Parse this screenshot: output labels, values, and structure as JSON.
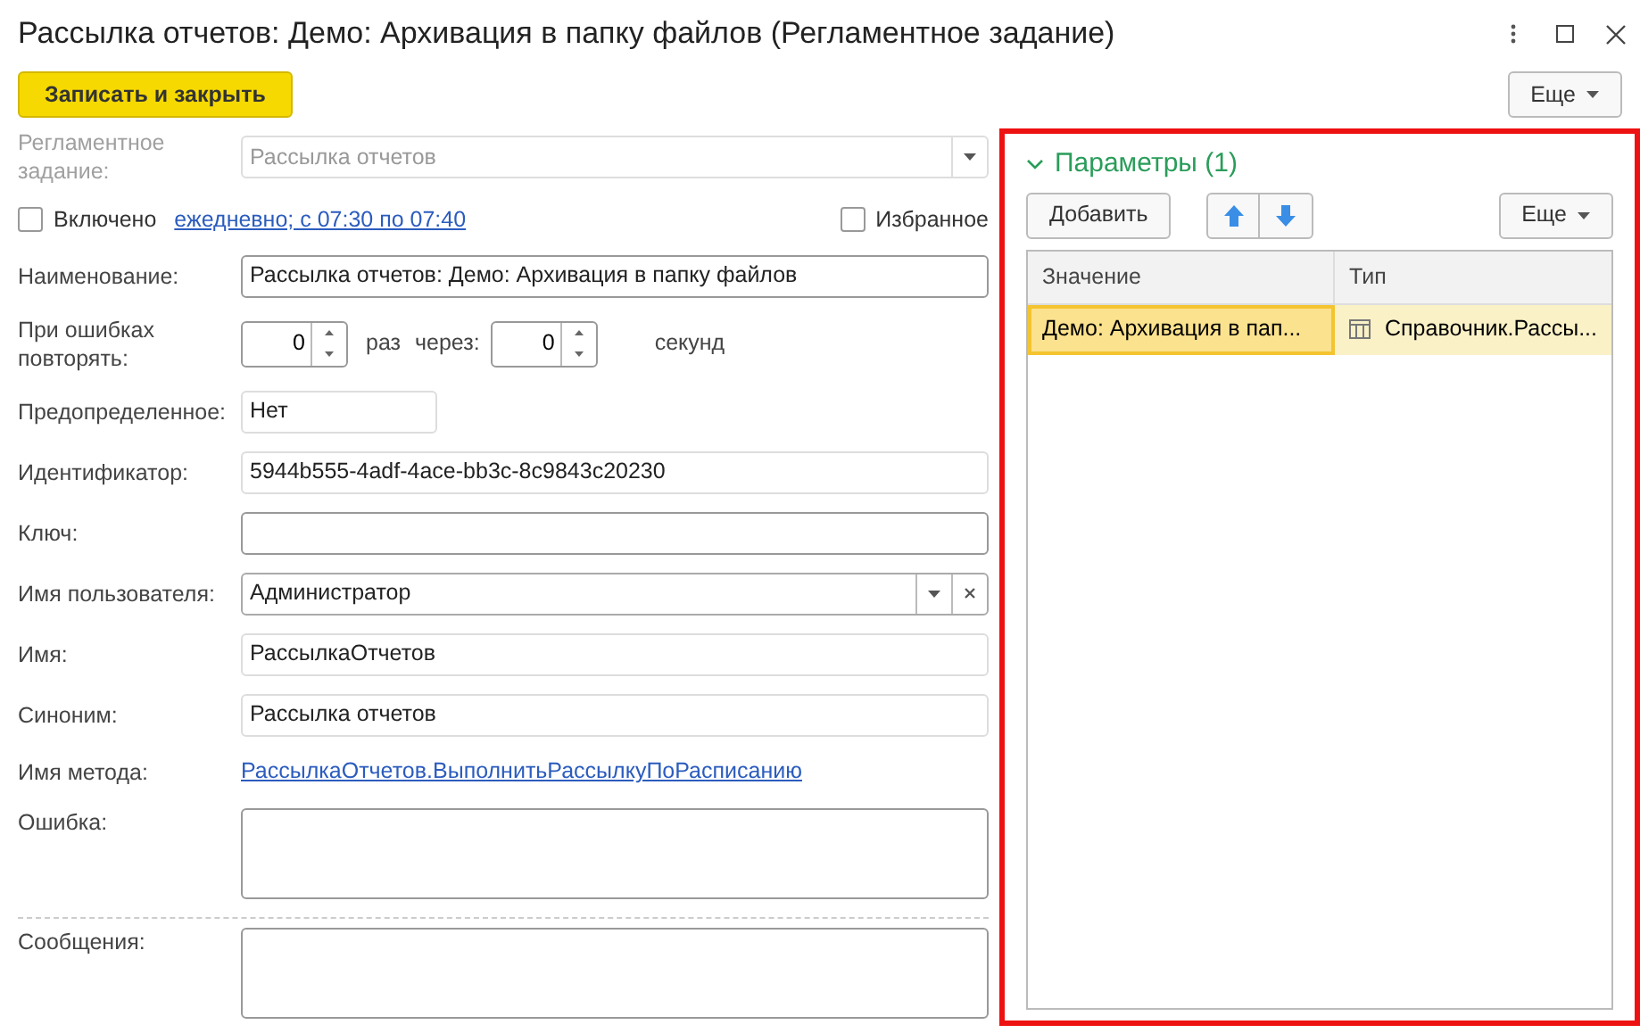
{
  "window": {
    "title": "Рассылка отчетов: Демо: Архивация в папку файлов (Регламентное задание)"
  },
  "toolbar": {
    "save_button": "Записать и закрыть",
    "more_button": "Еще"
  },
  "form": [
    {
      "kind": "select",
      "label": "Регламентное задание:",
      "value": "Рассылка отчетов",
      "disabled": true
    },
    {
      "kind": "checks",
      "checkbox": {
        "label": "Включено",
        "checked": false
      },
      "link": "ежедневно; с 07:30 по 07:40",
      "favorite": {
        "label": "Избранное",
        "checked": false
      }
    },
    {
      "kind": "text",
      "label": "Наименование:",
      "value": "Рассылка отчетов: Демо: Архивация в папку файлов",
      "readonly": false
    },
    {
      "kind": "retry",
      "label": "При ошибках повторять:",
      "count": "0",
      "unit": "раз",
      "via": "через:",
      "seconds": "0",
      "seconds_unit": "секунд"
    },
    {
      "kind": "short",
      "label": "Предопределенное:",
      "value": "Нет",
      "readonly": true
    },
    {
      "kind": "text",
      "label": "Идентификатор:",
      "value": "5944b555-4adf-4ace-bb3c-8c9843c20230",
      "readonly": true
    },
    {
      "kind": "text",
      "label": "Ключ:",
      "readonly": false
    },
    {
      "kind": "select_clear",
      "label": "Имя пользователя:",
      "value": "Администратор",
      "disabled": false
    },
    {
      "kind": "text",
      "label": "Имя:",
      "value": "РассылкаОтчетов",
      "readonly": true
    },
    {
      "kind": "text",
      "label": "Синоним:",
      "value": "Рассылка отчетов",
      "readonly": true
    },
    {
      "kind": "link",
      "label": "Имя метода:",
      "value": "РассылкаОтчетов.ВыполнитьРассылкуПоРасписанию"
    },
    {
      "kind": "textarea",
      "label": "Ошибка:",
      "divider_before": false
    },
    {
      "kind": "textarea",
      "label": "Сообщения:",
      "divider_before": true
    }
  ],
  "parameters": {
    "title": "Параметры (1)",
    "expanded": true,
    "highlighted": true,
    "add_button": "Добавить",
    "more_button": "Еще",
    "table": {
      "columns": [
        "Значение",
        "Тип"
      ],
      "rows": [
        {
          "selected": true,
          "cells": [
            "Демо: Архивация в пап...",
            "Справочник.Рассы..."
          ]
        }
      ]
    }
  }
}
